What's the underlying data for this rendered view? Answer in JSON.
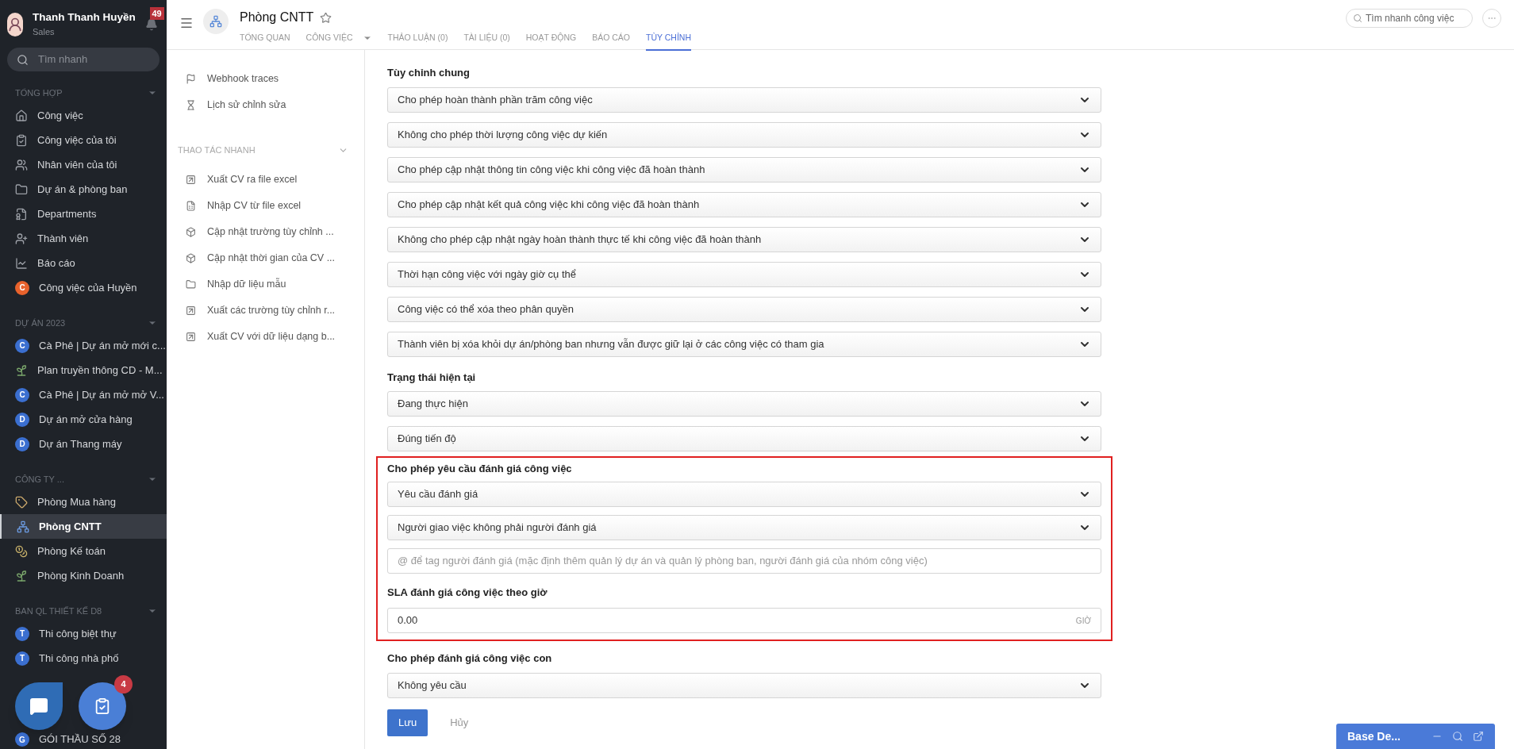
{
  "user": {
    "name": "Thanh Thanh Huyền",
    "role": "Sales",
    "notifications": "49"
  },
  "sidebar": {
    "search": {
      "placeholder": "Tìm nhanh"
    },
    "sections": [
      {
        "title": "TỔNG HỢP",
        "items": [
          {
            "label": "Công việc",
            "kind": "home",
            "selected": false
          },
          {
            "label": "Công việc của tôi",
            "kind": "task",
            "selected": false
          },
          {
            "label": "Nhân viên của tôi",
            "kind": "people",
            "selected": false
          },
          {
            "label": "Dự án & phòng ban",
            "kind": "folder",
            "selected": false
          },
          {
            "label": "Departments",
            "kind": "department",
            "selected": false
          },
          {
            "label": "Thành viên",
            "kind": "member",
            "selected": false
          },
          {
            "label": "Báo cáo",
            "kind": "chart",
            "selected": false
          },
          {
            "label": "Công việc của Huyền",
            "kind": "avatar",
            "letter": "C",
            "color": "#e8622c",
            "selected": false
          }
        ]
      },
      {
        "title": "DỰ ÁN 2023",
        "items": [
          {
            "label": "Cà Phê | Dự án mở mới c...",
            "kind": "avatar",
            "letter": "C",
            "color": "#3b6fd0",
            "selected": false
          },
          {
            "label": "Plan truyền thông CD - M...",
            "kind": "plant",
            "selected": false
          },
          {
            "label": "Cà Phê | Dự án mở mở V...",
            "kind": "avatar",
            "letter": "C",
            "color": "#3b6fd0",
            "selected": false
          },
          {
            "label": "Dự án mở cửa hàng",
            "kind": "avatar",
            "letter": "D",
            "color": "#3b6fd0",
            "selected": false
          },
          {
            "label": "Dự án Thang máy",
            "kind": "avatar",
            "letter": "D",
            "color": "#3b6fd0",
            "selected": false
          }
        ]
      },
      {
        "title": "CÔNG TY ...",
        "items": [
          {
            "label": "Phòng Mua hàng",
            "kind": "tag",
            "selected": false
          },
          {
            "label": "Phòng CNTT",
            "kind": "tree",
            "selected": true
          },
          {
            "label": "Phòng Kế toán",
            "kind": "coins",
            "selected": false
          },
          {
            "label": "Phòng Kinh Doanh",
            "kind": "plant",
            "selected": false
          }
        ]
      },
      {
        "title": "BAN QL THIẾT KẾ D8",
        "items": [
          {
            "label": "Thi công biệt thự",
            "kind": "avatar",
            "letter": "T",
            "color": "#3b6fd0",
            "selected": false
          },
          {
            "label": "Thi công nhà phố",
            "kind": "avatar",
            "letter": "T",
            "color": "#3b6fd0",
            "selected": false
          }
        ]
      }
    ],
    "last_item": {
      "label": "GÓI THẦU SỐ 28",
      "letter": "G",
      "color": "#3b6fd0"
    }
  },
  "header": {
    "title": "Phòng CNTT",
    "tabs": [
      {
        "label": "TỔNG QUAN",
        "selected": false,
        "dropdown": false
      },
      {
        "label": "CÔNG VIỆC",
        "selected": false,
        "dropdown": true
      },
      {
        "label": "THẢO LUẬN (0)",
        "selected": false,
        "dropdown": false
      },
      {
        "label": "TÀI LIỆU (0)",
        "selected": false,
        "dropdown": false
      },
      {
        "label": "HOẠT ĐỘNG",
        "selected": false,
        "dropdown": false
      },
      {
        "label": "BÁO CÁO",
        "selected": false,
        "dropdown": false
      },
      {
        "label": "TÙY CHỈNH",
        "selected": true,
        "dropdown": false
      }
    ],
    "search": {
      "placeholder": "Tìm nhanh công việc"
    }
  },
  "panel": {
    "items": [
      {
        "label": "Webhook traces",
        "kind": "flag"
      },
      {
        "label": "Lịch sử chỉnh sửa",
        "kind": "hourglass"
      }
    ],
    "quick_actions": {
      "title": "THAO TÁC NHANH",
      "items": [
        {
          "label": "Xuất CV ra file excel",
          "kind": "export"
        },
        {
          "label": "Nhập CV từ file excel",
          "kind": "excel"
        },
        {
          "label": "Cập nhật trường tùy chỉnh ...",
          "kind": "box"
        },
        {
          "label": "Cập nhật thời gian của CV ...",
          "kind": "box"
        },
        {
          "label": "Nhập dữ liệu mẫu",
          "kind": "folder"
        },
        {
          "label": "Xuất các trường tùy chỉnh r...",
          "kind": "export"
        },
        {
          "label": "Xuất CV với dữ liệu dạng b...",
          "kind": "export"
        }
      ]
    }
  },
  "form": {
    "sections": [
      {
        "title": "Tùy chỉnh chung",
        "highlighted": false,
        "fields": [
          {
            "kind": "select",
            "value": "Cho phép hoàn thành phần trăm công việc"
          },
          {
            "kind": "select",
            "value": "Không cho phép thời lượng công việc dự kiến"
          },
          {
            "kind": "select",
            "value": "Cho phép cập nhật thông tin công việc khi công việc đã hoàn thành"
          },
          {
            "kind": "select",
            "value": "Cho phép cập nhật kết quả công việc khi công việc đã hoàn thành"
          },
          {
            "kind": "select",
            "value": "Không cho phép cập nhật ngày hoàn thành thực tế khi công việc đã hoàn thành"
          },
          {
            "kind": "select",
            "value": "Thời hạn công việc với ngày giờ cụ thể"
          },
          {
            "kind": "select",
            "value": "Công việc có thể xóa theo phân quyền"
          },
          {
            "kind": "select",
            "value": "Thành viên bị xóa khỏi dự án/phòng ban nhưng vẫn được giữ lại ở các công việc có tham gia"
          }
        ]
      },
      {
        "title": "Trạng thái hiện tại",
        "highlighted": false,
        "fields": [
          {
            "kind": "select",
            "value": "Đang thực hiện"
          },
          {
            "kind": "select",
            "value": "Đúng tiến độ"
          }
        ]
      },
      {
        "title": "Cho phép yêu cầu đánh giá công việc",
        "highlighted": true,
        "fields": [
          {
            "kind": "select",
            "value": "Yêu cầu đánh giá"
          },
          {
            "kind": "select",
            "value": "Người giao việc không phải người đánh giá"
          },
          {
            "kind": "input",
            "placeholder": "@ để tag người đánh giá (mặc định thêm quản lý dự án và quản lý phòng ban, người đánh giá của nhóm công việc)"
          },
          {
            "kind": "label",
            "text": "SLA đánh giá công việc theo giờ"
          },
          {
            "kind": "number",
            "value": "0.00",
            "unit": "GIỜ"
          }
        ]
      },
      {
        "title": "Cho phép đánh giá công việc con",
        "highlighted": false,
        "fields": [
          {
            "kind": "select",
            "value": "Không yêu cầu"
          }
        ]
      }
    ],
    "save": "Lưu",
    "cancel": "Hủy"
  },
  "floating": {
    "task_badge": "4"
  },
  "chat_widget": {
    "title": "Base De..."
  }
}
